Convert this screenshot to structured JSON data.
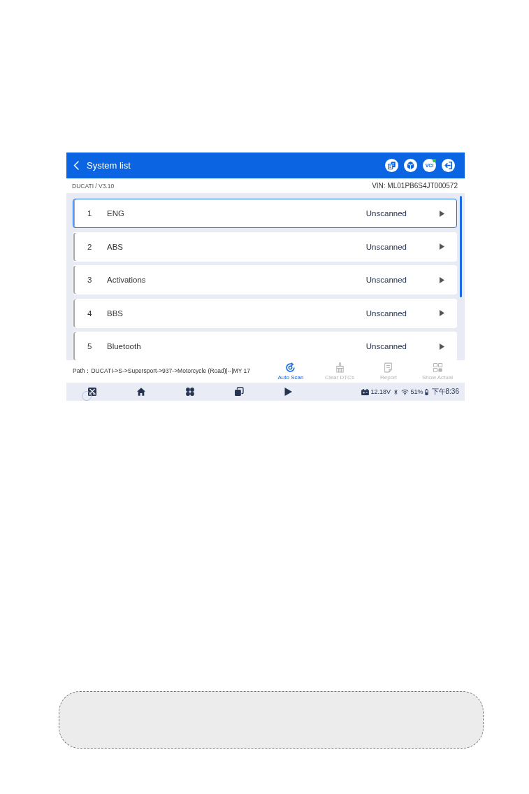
{
  "header": {
    "title": "System list",
    "vci": {
      "label": "VCI",
      "connected": true
    }
  },
  "info_bar": {
    "software": "DUCATI / V3.10",
    "vin": "VIN: ML01PB6S4JT000572"
  },
  "systems": [
    {
      "number": "1",
      "name": "ENG",
      "status": "Unscanned",
      "selected": true
    },
    {
      "number": "2",
      "name": "ABS",
      "status": "Unscanned",
      "selected": false
    },
    {
      "number": "3",
      "name": "Activations",
      "status": "Unscanned",
      "selected": false
    },
    {
      "number": "4",
      "name": "BBS",
      "status": "Unscanned",
      "selected": false
    },
    {
      "number": "5",
      "name": "Bluetooth",
      "status": "Unscanned",
      "selected": false
    }
  ],
  "path": "Path：DUCATI->S->Supersport->937->Motorcycle (Road)|--|MY 17",
  "actions": [
    {
      "kind": "auto_scan",
      "label": "Auto Scan",
      "disabled": false
    },
    {
      "kind": "clear_dtcs",
      "label": "Clear DTCs",
      "disabled": true
    },
    {
      "kind": "report",
      "label": "Report",
      "disabled": true
    },
    {
      "kind": "show_actual",
      "label": "Show Actual",
      "disabled": true
    }
  ],
  "nav_buttons": [
    {
      "kind": "screenshot"
    },
    {
      "kind": "home"
    },
    {
      "kind": "apps"
    },
    {
      "kind": "recents"
    },
    {
      "kind": "play"
    }
  ],
  "status_bar": {
    "voltage": "12.18V",
    "battery": "51%",
    "time": "下午8:36"
  }
}
